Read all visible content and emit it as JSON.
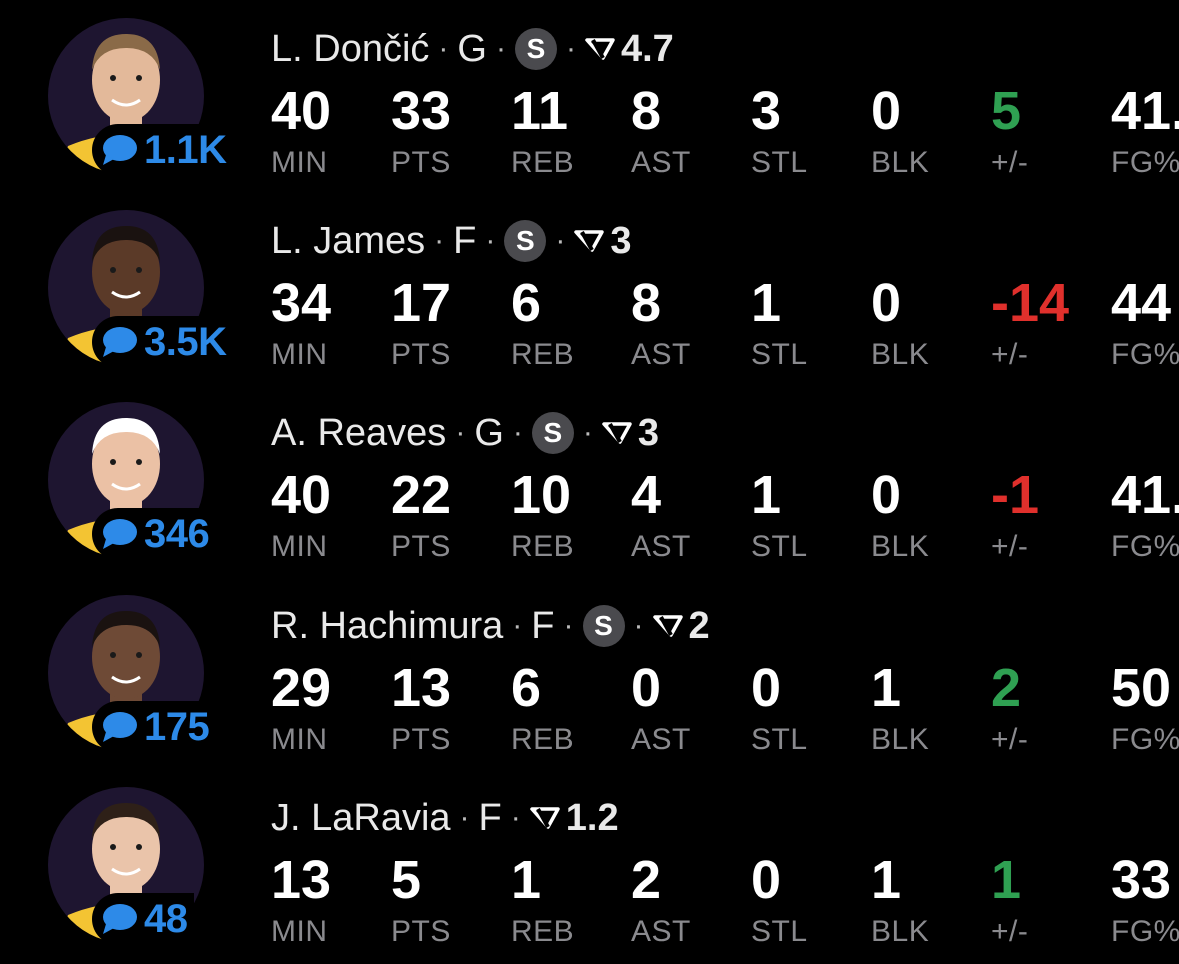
{
  "players": [
    {
      "name": "L. Dončić",
      "position": "G",
      "starter_badge": "S",
      "fantasy_icon": "fantasy-points-icon",
      "fantasy": "4.7",
      "comments": "1.1K",
      "stats": {
        "min": "40",
        "pts": "33",
        "reb": "11",
        "ast": "8",
        "stl": "3",
        "blk": "0",
        "plus_minus": "5",
        "fg": "41."
      },
      "skin": "#e3b99a",
      "hair": "#8a6a48"
    },
    {
      "name": "L. James",
      "position": "F",
      "starter_badge": "S",
      "fantasy_icon": "fantasy-points-icon",
      "fantasy": "3",
      "comments": "3.5K",
      "stats": {
        "min": "34",
        "pts": "17",
        "reb": "6",
        "ast": "8",
        "stl": "1",
        "blk": "0",
        "plus_minus": "-14",
        "fg": "44"
      },
      "skin": "#5b3a28",
      "hair": "#1a1210"
    },
    {
      "name": "A. Reaves",
      "position": "G",
      "starter_badge": "S",
      "fantasy_icon": "fantasy-points-icon",
      "fantasy": "3",
      "comments": "346",
      "stats": {
        "min": "40",
        "pts": "22",
        "reb": "10",
        "ast": "4",
        "stl": "1",
        "blk": "0",
        "plus_minus": "-1",
        "fg": "41."
      },
      "skin": "#ebc1a5",
      "hair": "#ffffff"
    },
    {
      "name": "R. Hachimura",
      "position": "F",
      "starter_badge": "S",
      "fantasy_icon": "fantasy-points-icon",
      "fantasy": "2",
      "comments": "175",
      "stats": {
        "min": "29",
        "pts": "13",
        "reb": "6",
        "ast": "0",
        "stl": "0",
        "blk": "1",
        "plus_minus": "2",
        "fg": "50"
      },
      "skin": "#6e4a36",
      "hair": "#1a1210"
    },
    {
      "name": "J. LaRavia",
      "position": "F",
      "starter_badge": "",
      "fantasy_icon": "fantasy-points-icon",
      "fantasy": "1.2",
      "comments": "48",
      "stats": {
        "min": "13",
        "pts": "5",
        "reb": "1",
        "ast": "2",
        "stl": "0",
        "blk": "1",
        "plus_minus": "1",
        "fg": "33"
      },
      "skin": "#eac4aa",
      "hair": "#2e2018"
    }
  ],
  "labels": {
    "min": "MIN",
    "pts": "PTS",
    "reb": "REB",
    "ast": "AST",
    "stl": "STL",
    "blk": "BLK",
    "plus_minus": "+/-",
    "fg": "FG%"
  },
  "colors": {
    "comment_blue": "#2d8ae8",
    "positive_green": "#2fa052",
    "negative_red": "#e0302c",
    "label_gray": "#8a8a8e",
    "badge_gray": "#4a4a4e",
    "jersey_gold": "#f3c433"
  }
}
